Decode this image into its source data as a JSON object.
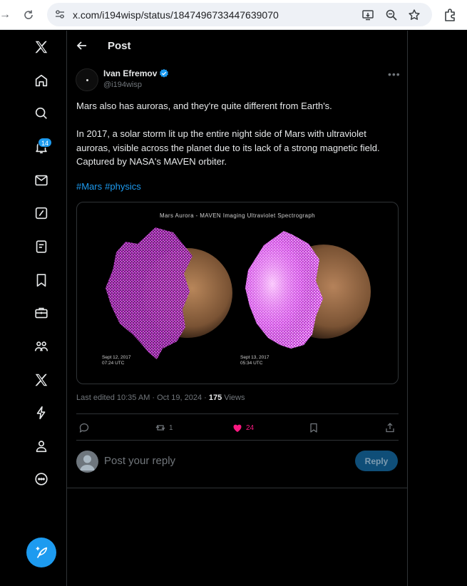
{
  "browser": {
    "url": "x.com/i194wisp/status/1847496733447639070"
  },
  "rail": {
    "notifications_badge": "14"
  },
  "header": {
    "title": "Post"
  },
  "post": {
    "author_name": "Ivan Efremov",
    "author_handle": "@i194wisp",
    "text_line1": "Mars also has auroras, and they're quite different from Earth's.",
    "text_para2": "In 2017, a solar storm lit up the entire night side of Mars with ultraviolet auroras, visible across the planet due to its lack of a strong magnetic field. Captured by NASA's MAVEN orbiter.",
    "hashtags": [
      "#Mars",
      "#physics"
    ],
    "media": {
      "title": "Mars Aurora - MAVEN Imaging Ultraviolet Spectrograph",
      "left_date": "Sept 12, 2017",
      "left_time": "07:24 UTC",
      "right_date": "Sept 13, 2017",
      "right_time": "05:34 UTC"
    },
    "meta_prefix": "Last edited 10:35 AM · Oct 19, 2024 · ",
    "views_count": "175",
    "views_label": " Views",
    "reposts": "1",
    "likes": "24"
  },
  "reply": {
    "placeholder": "Post your reply",
    "button_label": "Reply"
  },
  "colors": {
    "accent": "#1d9bf0",
    "like": "#f91880"
  }
}
